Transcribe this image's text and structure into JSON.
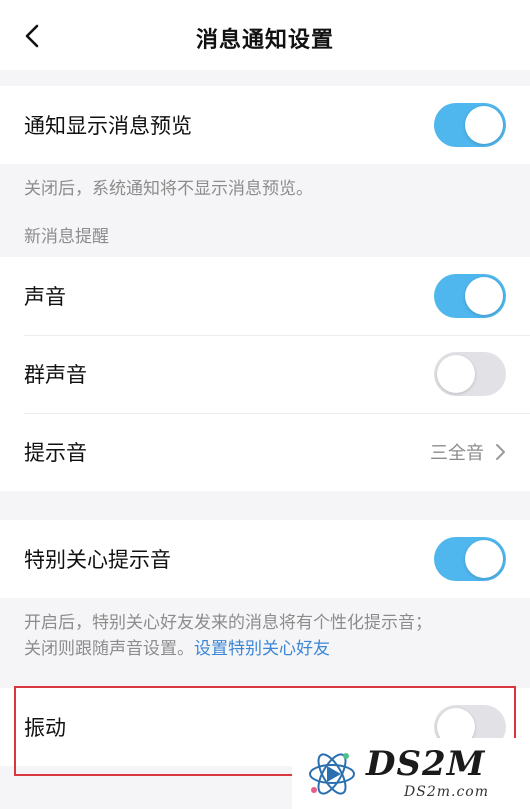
{
  "header": {
    "title": "消息通知设置",
    "back_icon": "chevron-left-icon"
  },
  "preview_group": {
    "label": "通知显示消息预览",
    "enabled": true,
    "note": "关闭后，系统通知将不显示消息预览。"
  },
  "new_message_section": {
    "heading": "新消息提醒",
    "items": [
      {
        "label": "声音",
        "enabled": true
      },
      {
        "label": "群声音",
        "enabled": false
      },
      {
        "label": "提示音",
        "value": "三全音"
      }
    ]
  },
  "special_group": {
    "label": "特别关心提示音",
    "enabled": true,
    "note_line1": "开启后，特别关心好友发来的消息将有个性化提示音；",
    "note_line2": "关闭则跟随声音设置。",
    "note_link": "设置特别关心好友"
  },
  "vibration_group": {
    "label": "振动",
    "enabled": false
  },
  "watermark": {
    "brand": "DS2M",
    "site": "DS2m.com"
  },
  "colors": {
    "toggle_on": "#4fb6ee",
    "toggle_off": "#e2e2e6",
    "link": "#3b87d6",
    "highlight_border": "#d9363e",
    "background": "#f5f5f7"
  }
}
